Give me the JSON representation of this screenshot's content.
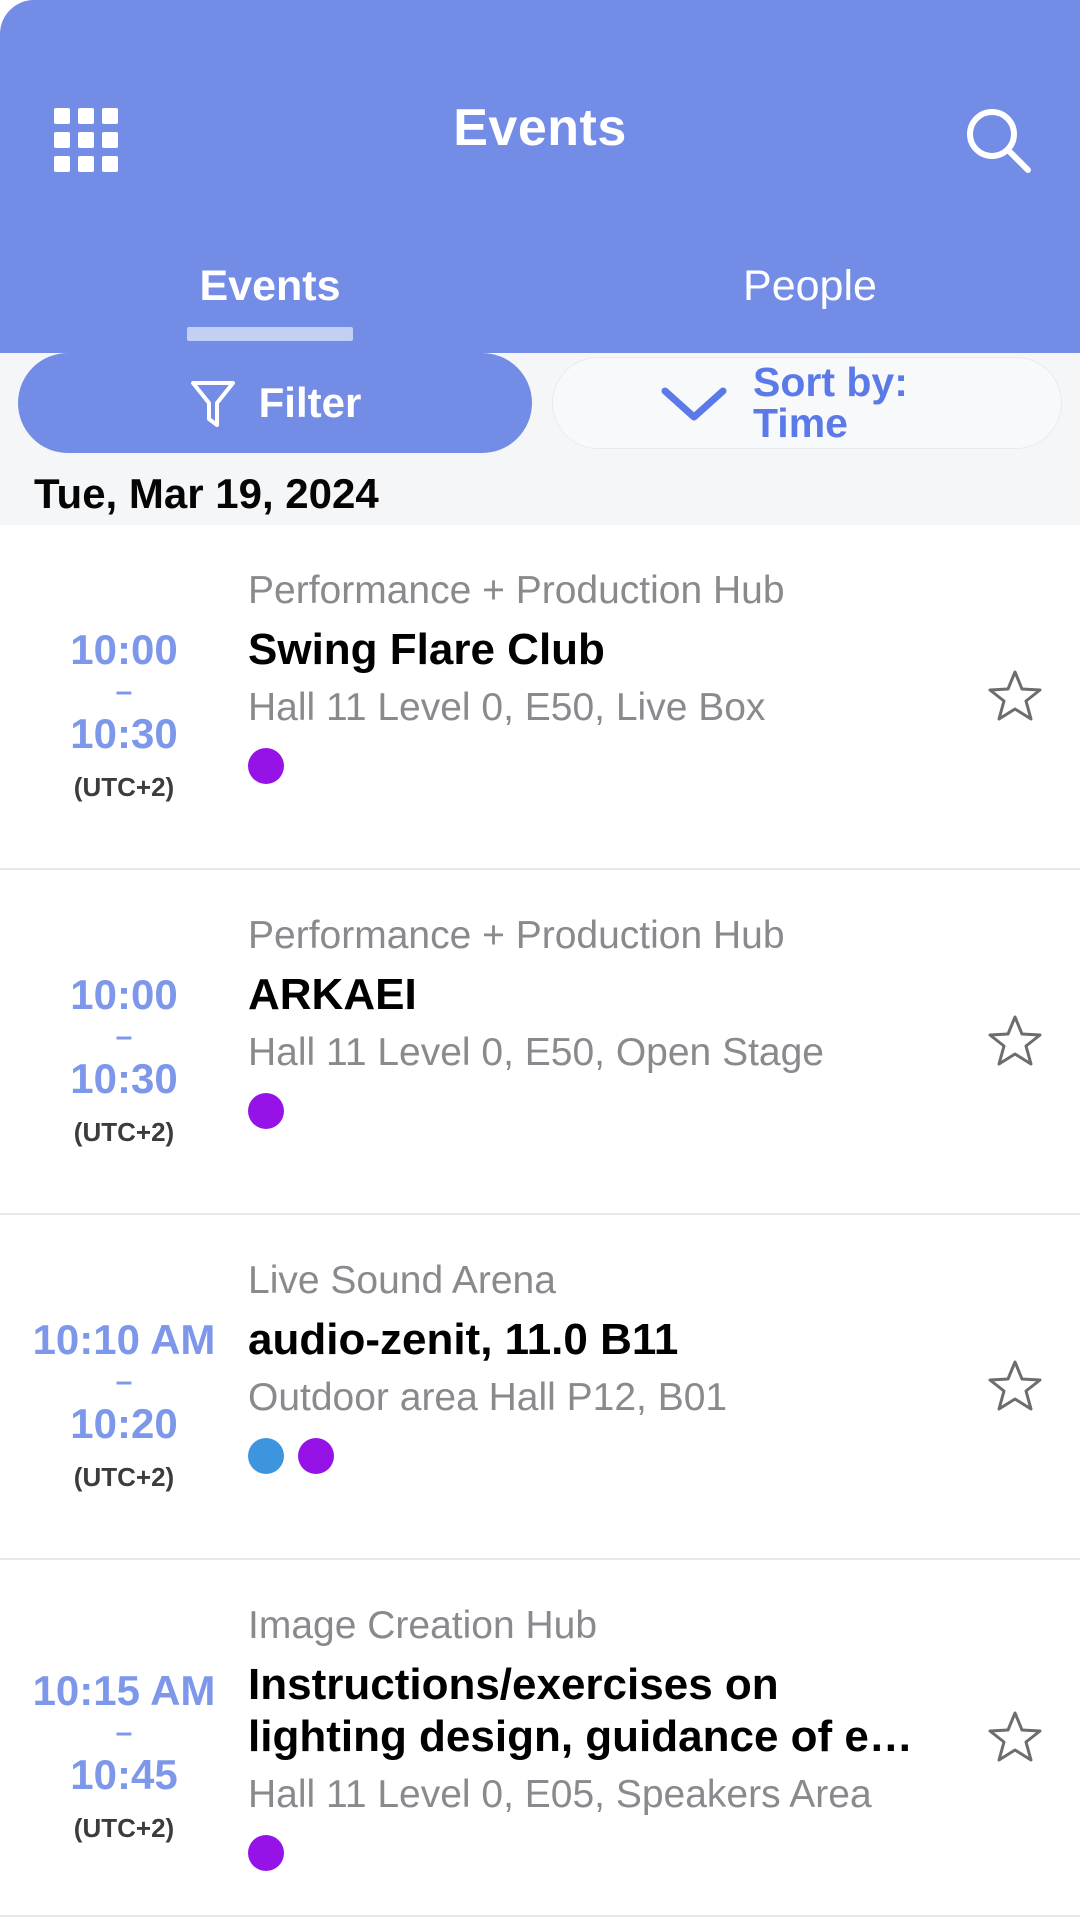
{
  "colors": {
    "header_blue": "#738ce6",
    "tab_indicator": "#c3d0f4",
    "time_blue": "#7d97ea",
    "sort_blue": "#5b7ae8",
    "dot_purple": "#9613e8",
    "dot_blue": "#3d95dd",
    "muted_gray": "#8a8a8e",
    "page_bg": "#f5f6f8"
  },
  "header": {
    "title": "Events",
    "grid_icon": "grid-menu-icon",
    "search_icon": "search-icon"
  },
  "tabs": [
    {
      "label": "Events",
      "active": true
    },
    {
      "label": "People",
      "active": false
    }
  ],
  "toolbar": {
    "filter_label": "Filter",
    "filter_icon": "funnel-icon",
    "sort_line1": "Sort by:",
    "sort_line2": "Time",
    "sort_icon": "chevron-down-icon"
  },
  "date_header": "Tue, Mar 19, 2024",
  "events": [
    {
      "time_start": "10:00",
      "time_dash": "–",
      "time_end": "10:30",
      "timezone": "(UTC+2)",
      "category": "Performance + Production Hub",
      "title": "Swing Flare Club",
      "location": "Hall 11 Level 0, E50, Live Box",
      "tags": [
        "#9613e8"
      ],
      "favorite_icon": "star-outline-icon"
    },
    {
      "time_start": "10:00",
      "time_dash": "–",
      "time_end": "10:30",
      "timezone": "(UTC+2)",
      "category": "Performance + Production Hub",
      "title": "ARKAEI",
      "location": "Hall 11 Level 0, E50, Open Stage",
      "tags": [
        "#9613e8"
      ],
      "favorite_icon": "star-outline-icon"
    },
    {
      "time_start": "10:10 AM",
      "time_dash": "–",
      "time_end": "10:20",
      "timezone": "(UTC+2)",
      "category": "Live Sound Arena",
      "title": "audio-zenit, 11.0 B11",
      "location": "Outdoor area Hall P12, B01",
      "tags": [
        "#3d95dd",
        "#9613e8"
      ],
      "favorite_icon": "star-outline-icon"
    },
    {
      "time_start": "10:15 AM",
      "time_dash": "–",
      "time_end": "10:45",
      "timezone": "(UTC+2)",
      "category": "Image Creation Hub",
      "title": "Instructions/exercises on lighting design, guidance of e…",
      "location": "Hall 11 Level 0, E05, Speakers Area",
      "tags": [
        "#9613e8"
      ],
      "favorite_icon": "star-outline-icon"
    }
  ]
}
